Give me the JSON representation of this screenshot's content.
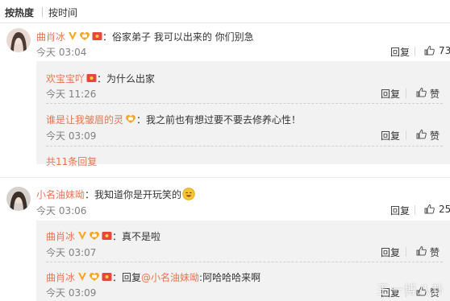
{
  "sort": {
    "hot_label": "按热度",
    "time_label": "按时间"
  },
  "comments": [
    {
      "user": "曲肖冰",
      "text": "：俗家弟子 我可以出来的 你们别急",
      "time": "今天 03:04",
      "reply_label": "回复",
      "like_count": "73"
    },
    {
      "user": "小名油妹呦",
      "text": "：我知道你是开玩笑的",
      "time": "今天 03:06",
      "reply_label": "回复",
      "like_count": "25"
    }
  ],
  "replies_1": [
    {
      "user": "欢宝宝吖",
      "text": "：为什么出家",
      "time": "今天 11:26",
      "reply_label": "回复",
      "like_label": "赞"
    },
    {
      "user": "谁是让我皱眉的灵",
      "text": "：我之前也有想过要不要去修养心性！",
      "time": "今天 03:09",
      "reply_label": "回复",
      "like_label": "赞"
    }
  ],
  "more_replies": "共11条回复",
  "replies_2": [
    {
      "user": "曲肖冰",
      "text": "：真不是啦",
      "time": "今天 03:07",
      "reply_label": "回复",
      "like_label": "赞"
    },
    {
      "user": "曲肖冰",
      "text_prefix": "：回复",
      "mention": "@小名油妹呦",
      "text_suffix": ":阿哈哈哈来啊",
      "time": "今天 03:09",
      "reply_label": "回复",
      "like_label": "赞"
    }
  ],
  "watermark": "王一博八卦",
  "colors": {
    "username": "#eb7350",
    "timestamp": "#808080",
    "subbox_bg": "#f2f2f2"
  }
}
